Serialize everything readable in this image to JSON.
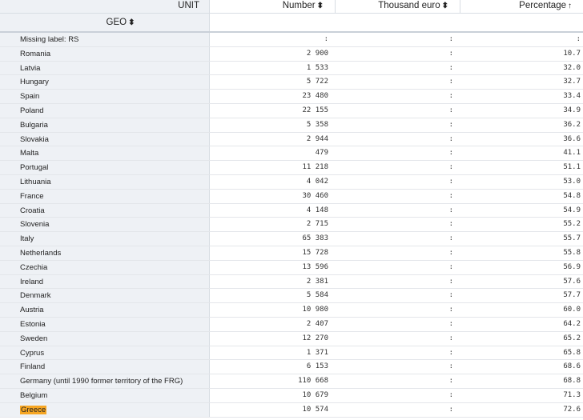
{
  "columns": {
    "unit": "UNIT",
    "number": "Number",
    "thousand_euro": "Thousand euro",
    "percentage": "Percentage",
    "geo": "GEO"
  },
  "icons": {
    "sort_both": "sort-both-icon",
    "sort_asc": "sort-ascending-icon"
  },
  "highlight_color": "#f6a623",
  "rows": [
    {
      "geo": "Missing label: RS",
      "number": ":",
      "thousand_euro": ":",
      "percentage": ":"
    },
    {
      "geo": "Romania",
      "number": "2 900",
      "thousand_euro": ":",
      "percentage": "10.7"
    },
    {
      "geo": "Latvia",
      "number": "1 533",
      "thousand_euro": ":",
      "percentage": "32.0"
    },
    {
      "geo": "Hungary",
      "number": "5 722",
      "thousand_euro": ":",
      "percentage": "32.7"
    },
    {
      "geo": "Spain",
      "number": "23 480",
      "thousand_euro": ":",
      "percentage": "33.4"
    },
    {
      "geo": "Poland",
      "number": "22 155",
      "thousand_euro": ":",
      "percentage": "34.9"
    },
    {
      "geo": "Bulgaria",
      "number": "5 358",
      "thousand_euro": ":",
      "percentage": "36.2"
    },
    {
      "geo": "Slovakia",
      "number": "2 944",
      "thousand_euro": ":",
      "percentage": "36.6"
    },
    {
      "geo": "Malta",
      "number": "479",
      "thousand_euro": ":",
      "percentage": "41.1"
    },
    {
      "geo": "Portugal",
      "number": "11 218",
      "thousand_euro": ":",
      "percentage": "51.1"
    },
    {
      "geo": "Lithuania",
      "number": "4 042",
      "thousand_euro": ":",
      "percentage": "53.0"
    },
    {
      "geo": "France",
      "number": "30 460",
      "thousand_euro": ":",
      "percentage": "54.8"
    },
    {
      "geo": "Croatia",
      "number": "4 148",
      "thousand_euro": ":",
      "percentage": "54.9"
    },
    {
      "geo": "Slovenia",
      "number": "2 715",
      "thousand_euro": ":",
      "percentage": "55.2"
    },
    {
      "geo": "Italy",
      "number": "65 383",
      "thousand_euro": ":",
      "percentage": "55.7"
    },
    {
      "geo": "Netherlands",
      "number": "15 728",
      "thousand_euro": ":",
      "percentage": "55.8"
    },
    {
      "geo": "Czechia",
      "number": "13 596",
      "thousand_euro": ":",
      "percentage": "56.9"
    },
    {
      "geo": "Ireland",
      "number": "2 381",
      "thousand_euro": ":",
      "percentage": "57.6"
    },
    {
      "geo": "Denmark",
      "number": "5 584",
      "thousand_euro": ":",
      "percentage": "57.7"
    },
    {
      "geo": "Austria",
      "number": "10 980",
      "thousand_euro": ":",
      "percentage": "60.0"
    },
    {
      "geo": "Estonia",
      "number": "2 407",
      "thousand_euro": ":",
      "percentage": "64.2"
    },
    {
      "geo": "Sweden",
      "number": "12 270",
      "thousand_euro": ":",
      "percentage": "65.2"
    },
    {
      "geo": "Cyprus",
      "number": "1 371",
      "thousand_euro": ":",
      "percentage": "65.8"
    },
    {
      "geo": "Finland",
      "number": "6 153",
      "thousand_euro": ":",
      "percentage": "68.6"
    },
    {
      "geo": "Germany (until 1990 former territory of the FRG)",
      "number": "110 668",
      "thousand_euro": ":",
      "percentage": "68.8"
    },
    {
      "geo": "Belgium",
      "number": "10 679",
      "thousand_euro": ":",
      "percentage": "71.3"
    },
    {
      "geo": "Greece",
      "number": "10 574",
      "thousand_euro": ":",
      "percentage": "72.6",
      "highlighted": true
    }
  ]
}
